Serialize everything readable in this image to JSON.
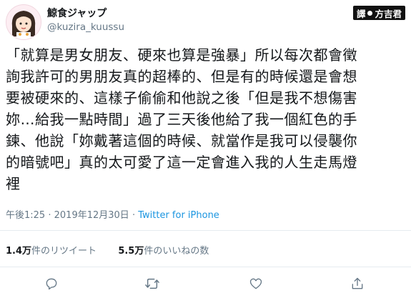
{
  "author": {
    "display_name": "鯨食ジャップ",
    "handle": "@kuzira_kuussu"
  },
  "watermark": {
    "left": "譯",
    "right": "方吉君"
  },
  "tweet": {
    "lines": [
      "「就算是男女朋友、硬來也算是強暴」所以每次都會徵",
      "詢我許可的男朋友真的超棒的、但是有的時候還是會想",
      "要被硬來的、這樣子偷偷和他說之後「但是我不想傷害",
      "妳…給我一點時間」過了三天後他給了我一個紅色的手",
      "鍊、他說「妳戴著這個的時候、就當作是我可以侵襲你",
      "的暗號吧」真的太可愛了這一定會進入我的人生走馬燈",
      "裡"
    ]
  },
  "meta": {
    "time": "午後1:25",
    "separator": "·",
    "date": "2019年12月30日",
    "source": "Twitter for iPhone"
  },
  "stats": {
    "retweets_count": "1.4万",
    "retweets_label": "件のリツイート",
    "likes_count": "5.5万",
    "likes_label": "件のいいねの数"
  },
  "actions": {
    "icons": [
      "reply-icon",
      "retweet-icon",
      "like-icon",
      "share-icon"
    ]
  }
}
